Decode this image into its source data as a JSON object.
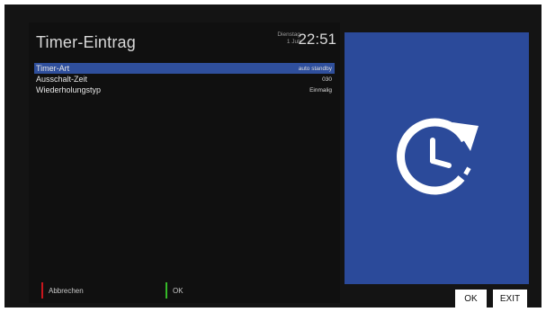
{
  "header": {
    "title": "Timer-Eintrag",
    "day": "Dienstag",
    "date": "1 Juli",
    "time": "22:51"
  },
  "menu": {
    "items": [
      {
        "label": "Timer-Art",
        "value": "auto standby",
        "selected": true
      },
      {
        "label": "Ausschalt-Zeit",
        "value": "030",
        "selected": false
      },
      {
        "label": "Wiederholungstyp",
        "value": "Einmalig",
        "selected": false
      }
    ]
  },
  "footer": {
    "cancel_label": "Abbrechen",
    "cancel_color": "#c8161d",
    "ok_label": "OK",
    "ok_color": "#35b928"
  },
  "right_panel": {
    "icon": "timer-clock-icon",
    "bg_color": "#2b4a9a",
    "ok_button": "OK",
    "exit_button": "EXIT"
  }
}
